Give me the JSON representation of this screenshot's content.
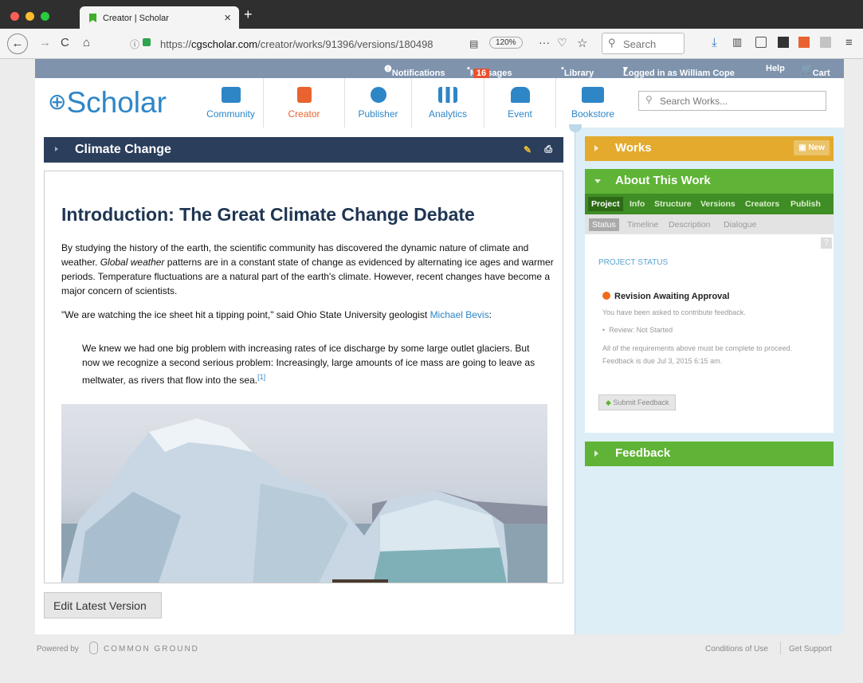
{
  "browser": {
    "tab_title": "Creator | Scholar",
    "url_prefix": "https://",
    "url_domain": "cgscholar.com",
    "url_path": "/creator/works/91396/versions/180498",
    "zoom": "120%",
    "search_placeholder": "Search"
  },
  "topnav": {
    "notifications": "Notifications",
    "messages": "Messages",
    "messages_count": "16",
    "library": "Library",
    "logged_in": "Logged in as William Cope",
    "help": "Help",
    "cart": "Cart"
  },
  "header": {
    "logo": "Scholar",
    "nav": [
      "Community",
      "Creator",
      "Publisher",
      "Analytics",
      "Event",
      "Bookstore"
    ],
    "search_placeholder": "Search Works..."
  },
  "doc": {
    "bar_title": "Climate Change",
    "heading": "Introduction: The Great Climate Change Debate",
    "p1_a": "By studying the history of the earth, the scientific community has discovered the dynamic nature of climate and weather. ",
    "p1_em": "Global weather",
    "p1_b": " patterns are in a constant state of change as evidenced by alternating ice ages and warmer periods. Temperature fluctuations are a natural part of the earth's climate. However, recent changes have become a major concern of scientists.",
    "p2_a": "\"We are watching the ice sheet hit a tipping point,\" said Ohio State University geologist ",
    "p2_link": "Michael Bevis",
    "p2_b": ":",
    "quote": "We knew we had one big problem with increasing rates of ice discharge by some large outlet glaciers. But now we recognize a second serious problem: Increasingly, large amounts of ice mass are going to leave as meltwater, as rivers that flow into the sea.",
    "footnote": "[1]",
    "edit_button": "Edit Latest Version"
  },
  "sidebar": {
    "works": "Works",
    "new": "New",
    "about": "About This Work",
    "tabs": [
      "Project",
      "Info",
      "Structure",
      "Versions",
      "Creators",
      "Publish"
    ],
    "subtabs": [
      "Status",
      "Timeline",
      "Description",
      "Dialogue"
    ],
    "help": "?",
    "project_status": "PROJECT STATUS",
    "revision": "Revision Awaiting Approval",
    "asked": "You have been asked to contribute feedback.",
    "review": "Review: Not Started",
    "requirements": "All of the requirements above must be complete to proceed. Feedback is due Jul 3, 2015 6:15 am.",
    "submit": "Submit Feedback",
    "feedback": "Feedback"
  },
  "footer": {
    "powered": "Powered by",
    "brand": "COMMON GROUND",
    "conditions": "Conditions of Use",
    "support": "Get Support"
  },
  "colors": {
    "accent": "#2e86c7",
    "works": "#e3aa2e",
    "about": "#5fb336",
    "status_dot": "#f26b1d"
  }
}
